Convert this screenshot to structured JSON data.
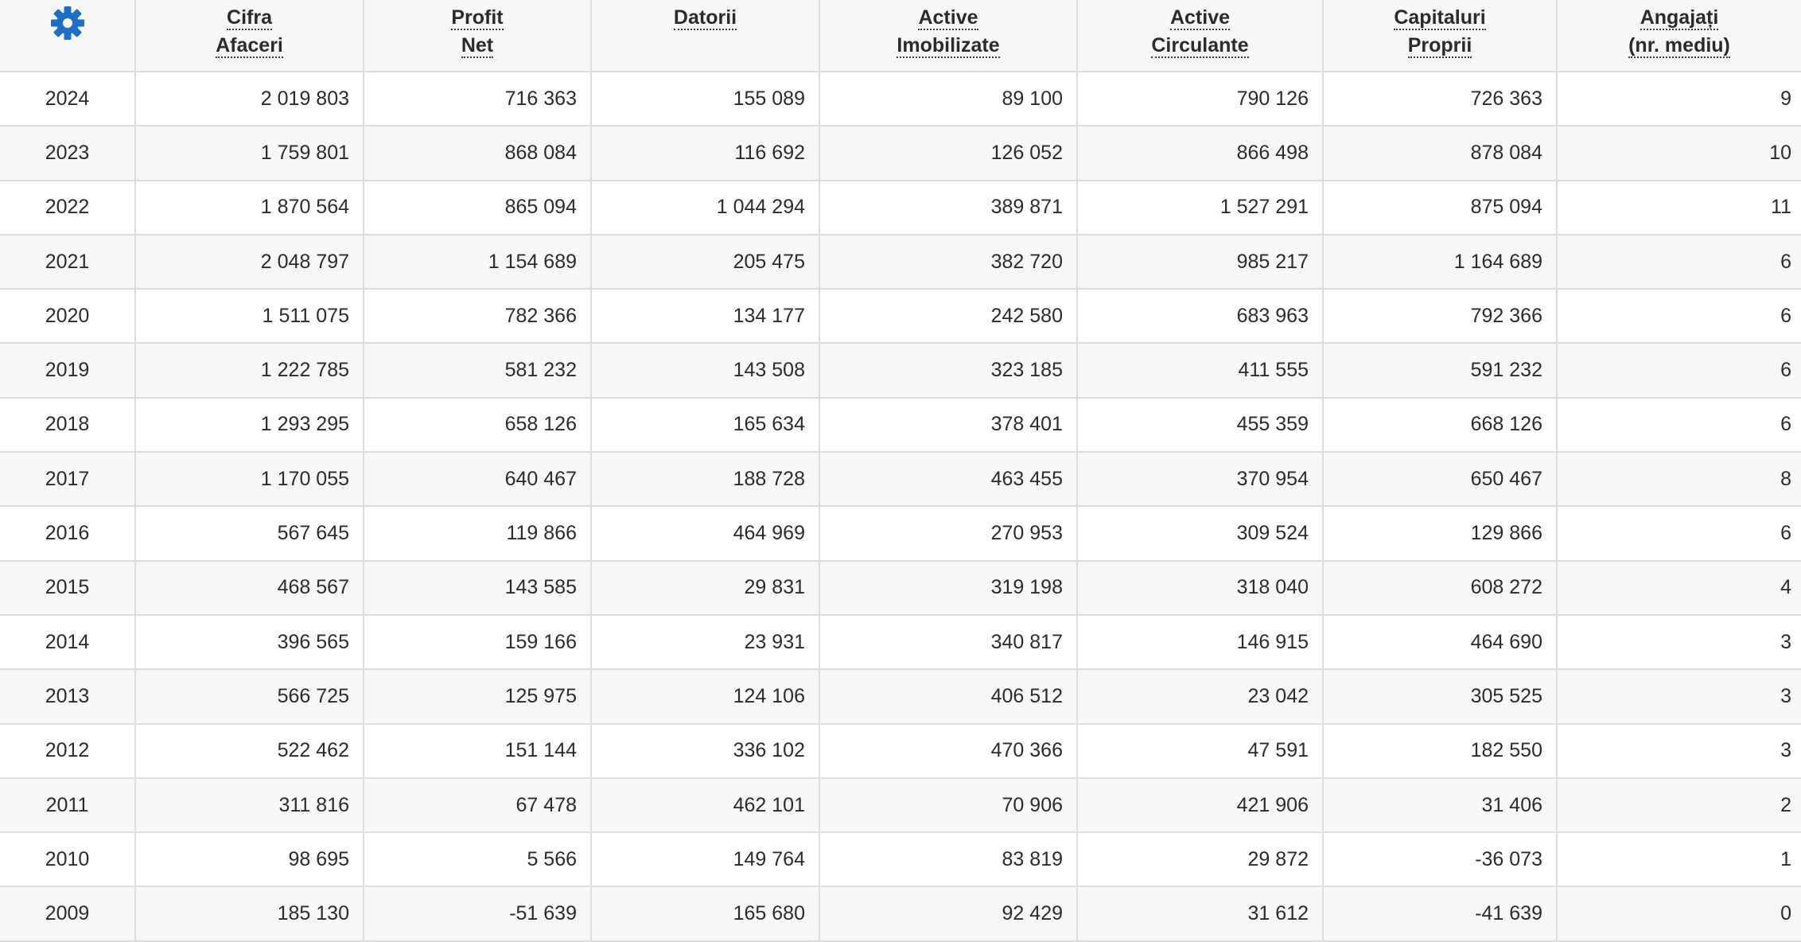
{
  "settings": {
    "icon": "gear-icon",
    "accent_color": "#1f6fc5"
  },
  "columns": [
    {
      "key": "cifra_afaceri",
      "lines": [
        "Cifra",
        "Afaceri"
      ]
    },
    {
      "key": "profit_net",
      "lines": [
        "Profit",
        "Net"
      ]
    },
    {
      "key": "datorii",
      "lines": [
        "Datorii"
      ]
    },
    {
      "key": "active_imobilizate",
      "lines": [
        "Active",
        "Imobilizate"
      ]
    },
    {
      "key": "active_circulante",
      "lines": [
        "Active",
        "Circulante"
      ]
    },
    {
      "key": "capitaluri_proprii",
      "lines": [
        "Capitaluri",
        "Proprii"
      ]
    },
    {
      "key": "angajati",
      "lines": [
        "Angajați",
        "(nr. mediu)"
      ]
    }
  ],
  "rows": [
    [
      "2024",
      "2 019 803",
      "716 363",
      "155 089",
      "89 100",
      "790 126",
      "726 363",
      "9"
    ],
    [
      "2023",
      "1 759 801",
      "868 084",
      "116 692",
      "126 052",
      "866 498",
      "878 084",
      "10"
    ],
    [
      "2022",
      "1 870 564",
      "865 094",
      "1 044 294",
      "389 871",
      "1 527 291",
      "875 094",
      "11"
    ],
    [
      "2021",
      "2 048 797",
      "1 154 689",
      "205 475",
      "382 720",
      "985 217",
      "1 164 689",
      "6"
    ],
    [
      "2020",
      "1 511 075",
      "782 366",
      "134 177",
      "242 580",
      "683 963",
      "792 366",
      "6"
    ],
    [
      "2019",
      "1 222 785",
      "581 232",
      "143 508",
      "323 185",
      "411 555",
      "591 232",
      "6"
    ],
    [
      "2018",
      "1 293 295",
      "658 126",
      "165 634",
      "378 401",
      "455 359",
      "668 126",
      "6"
    ],
    [
      "2017",
      "1 170 055",
      "640 467",
      "188 728",
      "463 455",
      "370 954",
      "650 467",
      "8"
    ],
    [
      "2016",
      "567 645",
      "119 866",
      "464 969",
      "270 953",
      "309 524",
      "129 866",
      "6"
    ],
    [
      "2015",
      "468 567",
      "143 585",
      "29 831",
      "319 198",
      "318 040",
      "608 272",
      "4"
    ],
    [
      "2014",
      "396 565",
      "159 166",
      "23 931",
      "340 817",
      "146 915",
      "464 690",
      "3"
    ],
    [
      "2013",
      "566 725",
      "125 975",
      "124 106",
      "406 512",
      "23 042",
      "305 525",
      "3"
    ],
    [
      "2012",
      "522 462",
      "151 144",
      "336 102",
      "470 366",
      "47 591",
      "182 550",
      "3"
    ],
    [
      "2011",
      "311 816",
      "67 478",
      "462 101",
      "70 906",
      "421 906",
      "31 406",
      "2"
    ],
    [
      "2010",
      "98 695",
      "5 566",
      "149 764",
      "83 819",
      "29 872",
      "-36 073",
      "1"
    ],
    [
      "2009",
      "185 130",
      "-51 639",
      "165 680",
      "92 429",
      "31 612",
      "-41 639",
      "0"
    ]
  ]
}
